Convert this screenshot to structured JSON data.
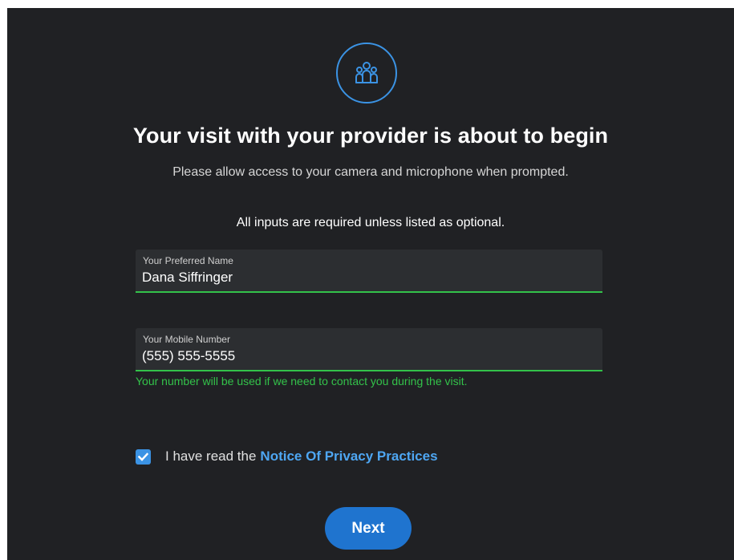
{
  "header": {
    "icon": "people-group-icon",
    "title": "Your visit with your provider is about to begin",
    "subtitle": "Please allow access to your camera and microphone when prompted."
  },
  "form": {
    "required_note": "All inputs are required unless listed as optional.",
    "name_field": {
      "label": "Your Preferred Name",
      "value": "Dana Siffringer"
    },
    "phone_field": {
      "label": "Your Mobile Number",
      "value": "(555) 555-5555",
      "helper": "Your number will be used if we need to contact you during the visit."
    },
    "consent": {
      "checked": true,
      "text": "I have read the",
      "link_text": "Notice Of Privacy Practices"
    },
    "next_label": "Next"
  },
  "colors": {
    "background": "#202124",
    "accent": "#3b93e4",
    "button": "#1f74cf",
    "valid": "#33c24a",
    "link": "#4ea6f2"
  }
}
